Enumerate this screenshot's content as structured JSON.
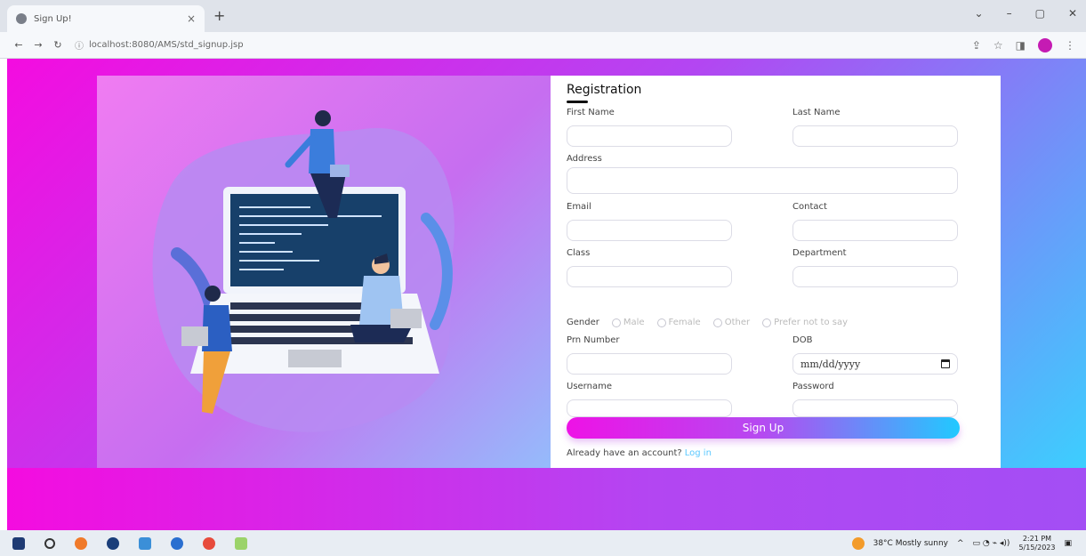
{
  "browser": {
    "tab_title": "Sign Up!",
    "tab_close": "×",
    "new_tab": "+",
    "url": "localhost:8080/AMS/std_signup.jsp",
    "window_controls": [
      "⌄",
      "–",
      "▢",
      "✕"
    ]
  },
  "form": {
    "title": "Registration",
    "labels": {
      "first_name": "First Name",
      "last_name": "Last Name",
      "address": "Address",
      "email": "Email",
      "contact": "Contact",
      "class": "Class",
      "department": "Department",
      "gender": "Gender",
      "prn": "Prn Number",
      "dob": "DOB",
      "username": "Username",
      "password": "Password"
    },
    "gender_options": [
      "Male",
      "Female",
      "Other",
      "Prefer not to say"
    ],
    "dob_placeholder": "mm/dd/yyyy",
    "submit_label": "Sign Up",
    "login_prompt": "Already have an account?",
    "login_link": "Log in"
  },
  "taskbar": {
    "weather": "38°C Mostly sunny",
    "time": "2:21 PM",
    "date": "5/15/2023"
  },
  "colors": {
    "gradient_start": "#f40ce0",
    "gradient_end": "#33d9ff",
    "button_accent": "#b54af1",
    "login_link": "#5ac8ff"
  }
}
